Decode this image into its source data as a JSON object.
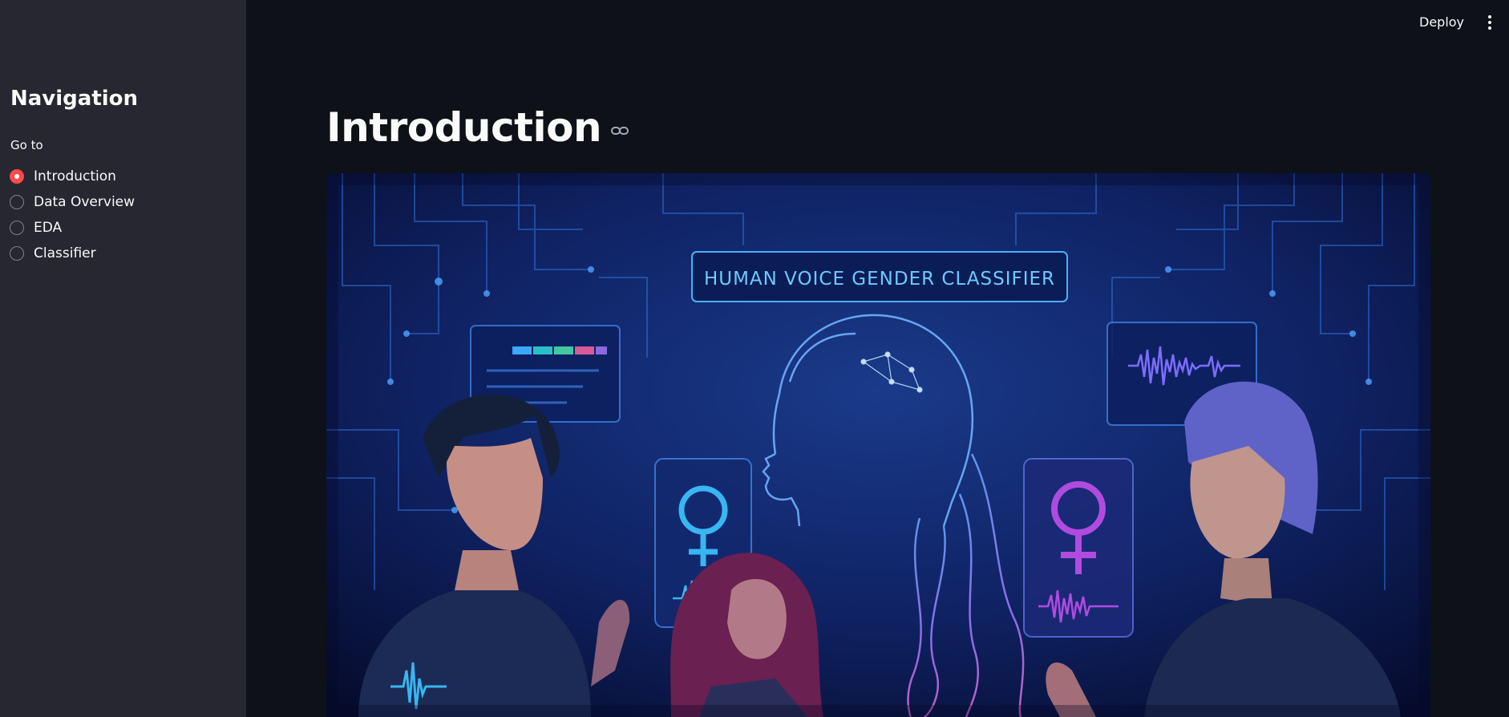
{
  "sidebar": {
    "title": "Navigation",
    "radio_label": "Go to",
    "options": [
      {
        "label": "Introduction",
        "selected": true
      },
      {
        "label": "Data Overview",
        "selected": false
      },
      {
        "label": "EDA",
        "selected": false
      },
      {
        "label": "Classifier",
        "selected": false
      }
    ]
  },
  "header": {
    "deploy_label": "Deploy",
    "menu_icon": "vertical-ellipsis-icon"
  },
  "main": {
    "title": "Introduction",
    "anchor_icon": "link-icon",
    "hero_image": {
      "banner_text": "HUMAN VOICE GENDER CLASSIFIER"
    }
  },
  "colors": {
    "app_bg": "#0e1117",
    "sidebar_bg": "#262730",
    "accent": "#ff4b4b",
    "text": "#fafafa"
  }
}
